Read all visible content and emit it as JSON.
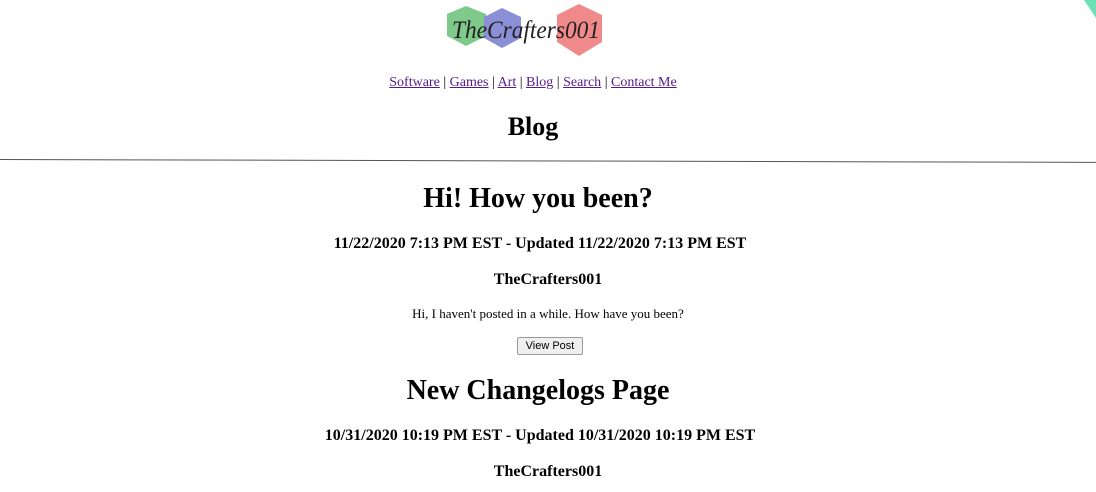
{
  "logo": {
    "text": "TheCrafters001"
  },
  "nav": {
    "items": [
      "Software",
      "Games",
      "Art",
      "Blog",
      "Search",
      "Contact Me"
    ],
    "separator": "|"
  },
  "page_title": "Blog",
  "posts": [
    {
      "title": "Hi! How you been?",
      "date": "11/22/2020 7:13 PM EST - Updated 11/22/2020 7:13 PM EST",
      "author": "TheCrafters001",
      "excerpt": "Hi, I haven't posted in a while. How have you been?",
      "button": "View Post"
    },
    {
      "title": "New Changelogs Page",
      "date": "10/31/2020 10:19 PM EST - Updated 10/31/2020 10:19 PM EST",
      "author": "TheCrafters001"
    }
  ],
  "colors": {
    "hex_green": "#7fc98a",
    "hex_blue": "#8a8fd6",
    "hex_red": "#f08a8a",
    "link": "#551a8b",
    "corner_accent": "#6ee0b8"
  }
}
